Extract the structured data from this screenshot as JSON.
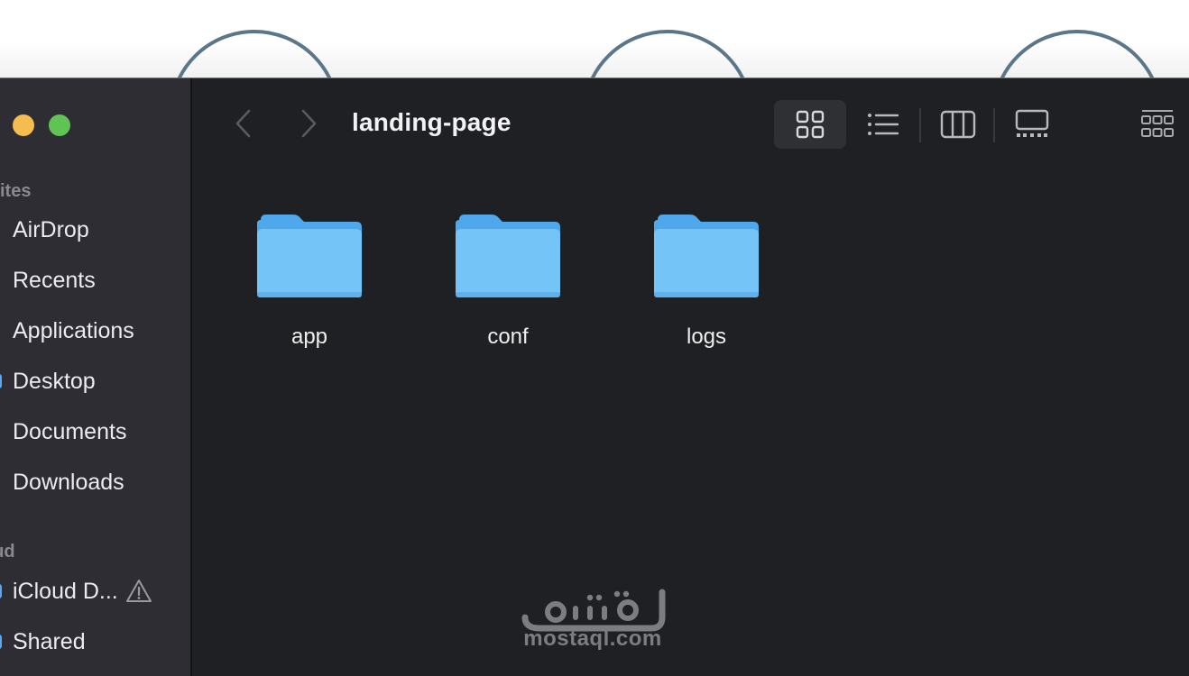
{
  "window": {
    "title": "landing-page"
  },
  "sidebar": {
    "sections": [
      {
        "title": "orites"
      },
      {
        "title": "oud"
      }
    ],
    "favorites": [
      {
        "label": "AirDrop"
      },
      {
        "label": "Recents"
      },
      {
        "label": "Applications"
      },
      {
        "label": "Desktop"
      },
      {
        "label": "Documents"
      },
      {
        "label": "Downloads"
      }
    ],
    "icloud": [
      {
        "label": "iCloud D..."
      },
      {
        "label": "Shared"
      }
    ]
  },
  "toolbar": {
    "views": [
      "icon-view",
      "list-view",
      "column-view",
      "gallery-view"
    ],
    "active_view": "icon-view"
  },
  "content": {
    "folders": [
      {
        "name": "app"
      },
      {
        "name": "conf"
      },
      {
        "name": "logs"
      }
    ]
  },
  "watermark": {
    "text": "mostaql.com",
    "brand": "مستقل"
  },
  "colors": {
    "window_bg": "#1f2023",
    "sidebar_bg": "#2e2d33",
    "folder_blue": "#74c4f7",
    "arc_stroke": "#5c7689"
  }
}
